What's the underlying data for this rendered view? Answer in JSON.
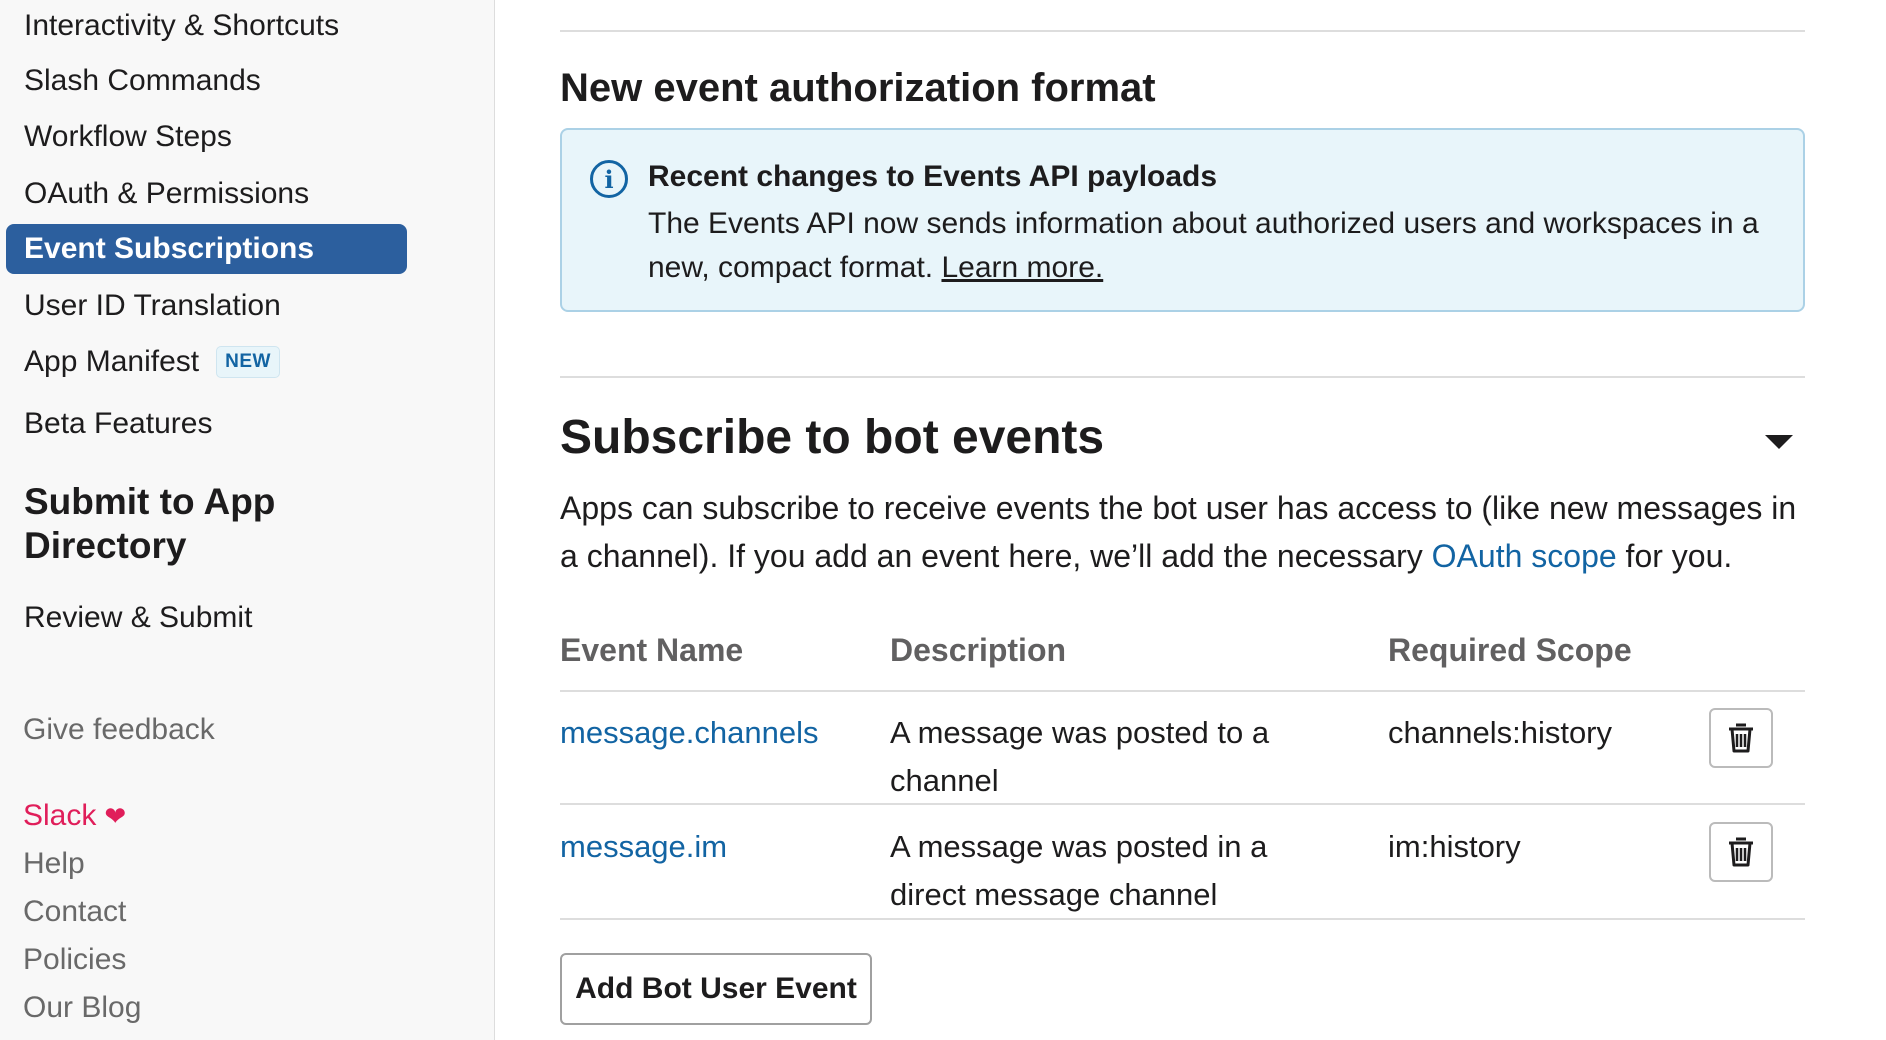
{
  "sidebar": {
    "items": [
      {
        "label": "Interactivity & Shortcuts"
      },
      {
        "label": "Slash Commands"
      },
      {
        "label": "Workflow Steps"
      },
      {
        "label": "OAuth & Permissions"
      },
      {
        "label": "Event Subscriptions",
        "active": true
      },
      {
        "label": "User ID Translation"
      },
      {
        "label": "App Manifest",
        "badge": "NEW"
      },
      {
        "label": "Beta Features"
      }
    ],
    "submit_section_title": "Submit to App Directory",
    "review_label": "Review & Submit",
    "feedback_label": "Give feedback",
    "footer": {
      "slack": "Slack",
      "help": "Help",
      "contact": "Contact",
      "policies": "Policies",
      "blog": "Our Blog"
    }
  },
  "main": {
    "auth_heading": "New event authorization format",
    "info": {
      "title": "Recent changes to Events API payloads",
      "body": "The Events API now sends information about authorized users and workspaces in a new, compact format.",
      "link": "Learn more."
    },
    "bot_events": {
      "heading": "Subscribe to bot events",
      "desc_part1": "Apps can subscribe to receive events the bot user has access to (like new messages in a channel). If you add an event here, we’ll add the necessary",
      "desc_link": "OAuth scope",
      "desc_part2": "for you.",
      "columns": [
        "Event Name",
        "Description",
        "Required Scope"
      ],
      "rows": [
        {
          "event": "message.channels",
          "description": "A message was posted to a channel",
          "scope": "channels:history"
        },
        {
          "event": "message.im",
          "description": "A message was posted in a direct message channel",
          "scope": "im:history"
        }
      ],
      "add_button": "Add Bot User Event"
    }
  },
  "colors": {
    "active_nav": "#2c5f9e",
    "link": "#1264a3",
    "info_bg": "#e8f5fa",
    "slack_pink": "#e01e5a"
  }
}
